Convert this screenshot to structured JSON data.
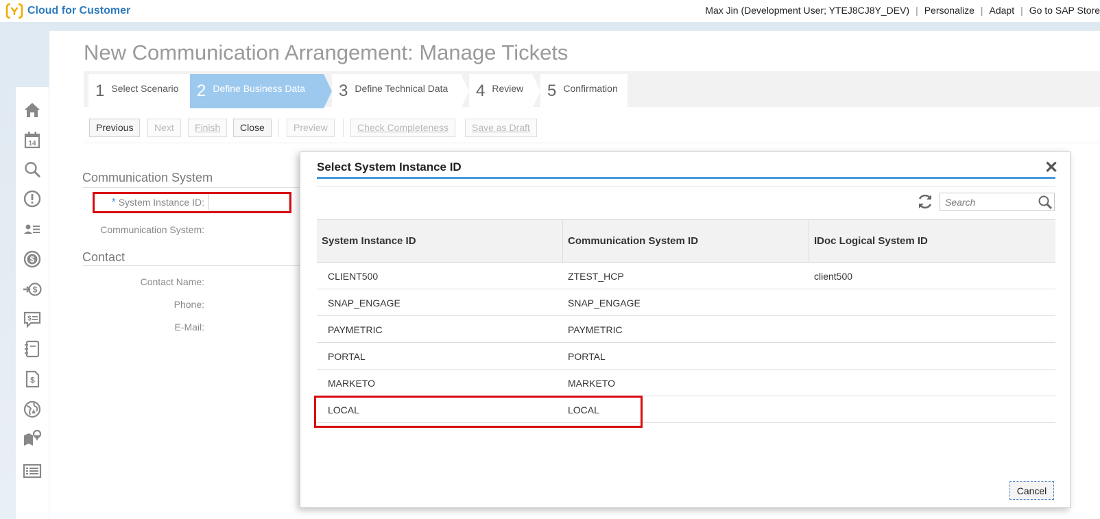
{
  "app": {
    "brand": "Cloud for Customer",
    "brand_color": "#2e7bbd"
  },
  "usernav": {
    "user": "Max Jin (Development User; YTEJ8CJ8Y_DEV)",
    "personalize": "Personalize",
    "adapt": "Adapt",
    "store": "Go to SAP Store"
  },
  "sidenav": {
    "items": [
      "home-icon",
      "calendar-icon",
      "search-icon",
      "alert-icon",
      "people-list-icon",
      "dollar-circle-icon",
      "dollar-arrow-icon",
      "dollar-chat-icon",
      "notebook-icon",
      "dollar-document-icon",
      "globe-icon",
      "map-pin-icon",
      "list-icon"
    ],
    "calendar_day": "14"
  },
  "page": {
    "title": "New Communication Arrangement: Manage Tickets"
  },
  "wizard": {
    "steps": [
      {
        "num": "1",
        "label": "Select Scenario"
      },
      {
        "num": "2",
        "label": "Define Business Data"
      },
      {
        "num": "3",
        "label": "Define Technical Data"
      },
      {
        "num": "4",
        "label": "Review"
      },
      {
        "num": "5",
        "label": "Confirmation"
      }
    ],
    "active_step": 2,
    "active_color": "#9ec9ef"
  },
  "toolbar": {
    "previous": "Previous",
    "next": "Next",
    "finish": "Finish",
    "close": "Close",
    "preview": "Preview",
    "check": "Check Completeness",
    "draft": "Save as Draft"
  },
  "form": {
    "section_comm": "Communication System",
    "required_mark": "*",
    "system_instance_label": "System Instance ID:",
    "system_instance_value": "",
    "comm_system_label": "Communication System:",
    "section_contact": "Contact",
    "contact_name_label": "Contact Name:",
    "phone_label": "Phone:",
    "email_label": "E-Mail:"
  },
  "dialog": {
    "title": "Select System Instance ID",
    "close": "✕",
    "search_placeholder": "Search",
    "columns": [
      "System Instance ID",
      "Communication System ID",
      "IDoc Logical System ID"
    ],
    "rows": [
      [
        "CLIENT500",
        "ZTEST_HCP",
        "client500"
      ],
      [
        "SNAP_ENGAGE",
        "SNAP_ENGAGE",
        ""
      ],
      [
        "PAYMETRIC",
        "PAYMETRIC",
        ""
      ],
      [
        "PORTAL",
        "PORTAL",
        ""
      ],
      [
        "MARKETO",
        "MARKETO",
        ""
      ],
      [
        "LOCAL",
        "LOCAL",
        ""
      ]
    ],
    "cancel": "Cancel"
  },
  "highlight_color": "#d90a10"
}
